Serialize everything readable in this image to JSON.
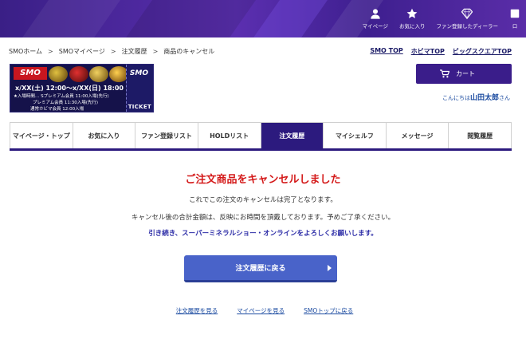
{
  "header": {
    "nav": [
      {
        "label": "マイページ",
        "icon": "user-icon"
      },
      {
        "label": "お気に入り",
        "icon": "star-icon"
      },
      {
        "label": "ファン登録したディーラー",
        "icon": "diamond-icon"
      },
      {
        "label": "ロ",
        "icon": "logout-icon"
      }
    ]
  },
  "breadcrumb": [
    "SMOホーム",
    "SMOマイページ",
    "注文履歴",
    "商品のキャンセル"
  ],
  "top_links": [
    "SMO TOP",
    "ホビマTOP",
    "ビッグスクエアTOP"
  ],
  "banner": {
    "logo": "SMO",
    "date_text": "x/XX(土) 12:00～x/XX(日) 18:00",
    "line1": "★入場時間… Sプレミアム会員 11:00入場(先行)",
    "line2": "プレミアム会員 11:30入場(先行)",
    "line3": "通常ホビマ会員 12:00入場",
    "side_logo": "SMO",
    "ticket": "TICKET"
  },
  "cart": {
    "label": "カート"
  },
  "greeting": {
    "prefix": "こんにちは",
    "name": "山田太郎",
    "suffix": "さん"
  },
  "tabs": [
    {
      "label": "マイページ・トップ",
      "active": false
    },
    {
      "label": "お気に入り",
      "active": false
    },
    {
      "label": "ファン登録リスト",
      "active": false
    },
    {
      "label": "HOLDリスト",
      "active": false
    },
    {
      "label": "注文履歴",
      "active": true
    },
    {
      "label": "マイシェルフ",
      "active": false
    },
    {
      "label": "メッセージ",
      "active": false
    },
    {
      "label": "閲覧履歴",
      "active": false
    }
  ],
  "content": {
    "title": "ご注文商品をキャンセルしました",
    "message1": "これでこの注文のキャンセルは完了となります。",
    "message2": "キャンセル後の合計金額は、反映にお時間を頂戴しております。予めご了承ください。",
    "message3": "引き続き、スーパーミネラルショー・オンラインをよろしくお願いします。",
    "back_button": "注文履歴に戻る"
  },
  "bottom_links": [
    "注文履歴を見る",
    "マイページを見る",
    "SMOトップに戻る"
  ],
  "colors": {
    "primary": "#2c1a7e",
    "title_red": "#d41a1a",
    "button_blue": "#4963c9",
    "link_blue": "#1a4aa0"
  }
}
